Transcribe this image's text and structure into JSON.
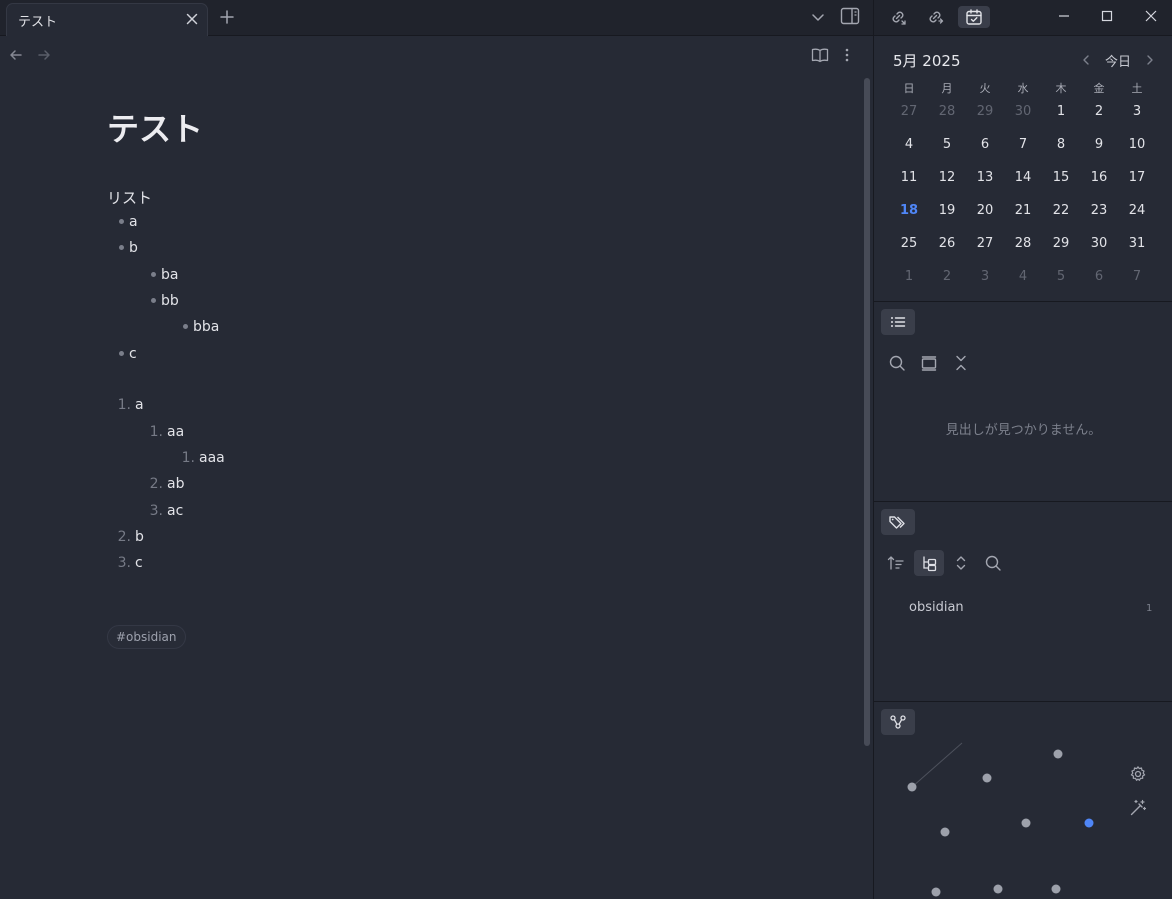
{
  "tab": {
    "title": "テスト"
  },
  "note": {
    "title": "テスト",
    "list_heading": "リスト",
    "bullets": [
      {
        "text": "a",
        "level": 1
      },
      {
        "text": "b",
        "level": 1
      },
      {
        "text": "ba",
        "level": 2
      },
      {
        "text": "bb",
        "level": 2
      },
      {
        "text": "bba",
        "level": 3
      },
      {
        "text": "c",
        "level": 1
      }
    ],
    "numbered": [
      {
        "num": "1.",
        "text": "a",
        "level": 1
      },
      {
        "num": "1.",
        "text": "aa",
        "level": 2
      },
      {
        "num": "1.",
        "text": "aaa",
        "level": 3
      },
      {
        "num": "2.",
        "text": "ab",
        "level": 2
      },
      {
        "num": "3.",
        "text": "ac",
        "level": 2
      },
      {
        "num": "2.",
        "text": "b",
        "level": 1
      },
      {
        "num": "3.",
        "text": "c",
        "level": 1
      }
    ],
    "tag": "#obsidian"
  },
  "calendar": {
    "title": "5月 2025",
    "today_label": "今日",
    "weekdays": [
      "日",
      "月",
      "火",
      "水",
      "木",
      "金",
      "土"
    ],
    "weeks": [
      [
        "27",
        "28",
        "29",
        "30",
        "1",
        "2",
        "3"
      ],
      [
        "4",
        "5",
        "6",
        "7",
        "8",
        "9",
        "10"
      ],
      [
        "11",
        "12",
        "13",
        "14",
        "15",
        "16",
        "17"
      ],
      [
        "18",
        "19",
        "20",
        "21",
        "22",
        "23",
        "24"
      ],
      [
        "25",
        "26",
        "27",
        "28",
        "29",
        "30",
        "31"
      ],
      [
        "1",
        "2",
        "3",
        "4",
        "5",
        "6",
        "7"
      ]
    ],
    "today": "18"
  },
  "outline": {
    "empty_message": "見出しが見つかりません。"
  },
  "tags_pane": {
    "items": [
      {
        "name": "obsidian",
        "count": "1"
      }
    ]
  },
  "colors": {
    "accent": "#4f86f7",
    "background": "#262a35",
    "titlebar": "#20232c"
  },
  "icons": {
    "tab_close": "close-icon",
    "tab_new": "plus-icon",
    "tab_list": "chevron-down-icon",
    "sidebar_toggle": "sidebar-right-icon",
    "back": "arrow-left-icon",
    "forward": "arrow-right-icon",
    "reading_view": "book-open-icon",
    "more": "more-vertical-icon",
    "backlinks": "link-incoming-icon",
    "outgoing_links": "link-outgoing-icon",
    "calendar": "calendar-check-icon",
    "minimize": "minimize-icon",
    "maximize": "maximize-icon",
    "close": "close-icon",
    "outline": "list-icon",
    "search": "search-icon",
    "collapse": "collapse-icon",
    "tags": "tags-icon",
    "sort": "sort-icon",
    "tree": "tree-icon",
    "expand": "chevrons-up-down-icon",
    "graph": "graph-icon",
    "settings": "gear-icon",
    "animate": "wand-icon"
  }
}
